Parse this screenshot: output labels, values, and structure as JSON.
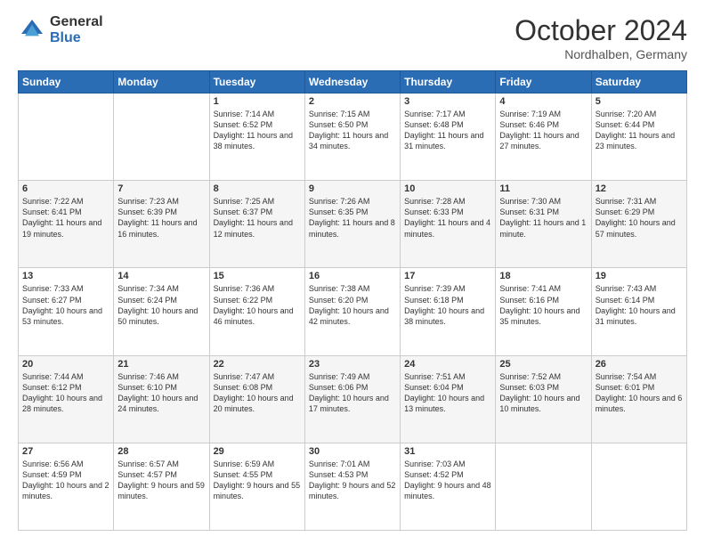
{
  "header": {
    "logo_general": "General",
    "logo_blue": "Blue",
    "month_title": "October 2024",
    "location": "Nordhalben, Germany"
  },
  "weekdays": [
    "Sunday",
    "Monday",
    "Tuesday",
    "Wednesday",
    "Thursday",
    "Friday",
    "Saturday"
  ],
  "weeks": [
    [
      {
        "day": "",
        "sunrise": "",
        "sunset": "",
        "daylight": ""
      },
      {
        "day": "",
        "sunrise": "",
        "sunset": "",
        "daylight": ""
      },
      {
        "day": "1",
        "sunrise": "Sunrise: 7:14 AM",
        "sunset": "Sunset: 6:52 PM",
        "daylight": "Daylight: 11 hours and 38 minutes."
      },
      {
        "day": "2",
        "sunrise": "Sunrise: 7:15 AM",
        "sunset": "Sunset: 6:50 PM",
        "daylight": "Daylight: 11 hours and 34 minutes."
      },
      {
        "day": "3",
        "sunrise": "Sunrise: 7:17 AM",
        "sunset": "Sunset: 6:48 PM",
        "daylight": "Daylight: 11 hours and 31 minutes."
      },
      {
        "day": "4",
        "sunrise": "Sunrise: 7:19 AM",
        "sunset": "Sunset: 6:46 PM",
        "daylight": "Daylight: 11 hours and 27 minutes."
      },
      {
        "day": "5",
        "sunrise": "Sunrise: 7:20 AM",
        "sunset": "Sunset: 6:44 PM",
        "daylight": "Daylight: 11 hours and 23 minutes."
      }
    ],
    [
      {
        "day": "6",
        "sunrise": "Sunrise: 7:22 AM",
        "sunset": "Sunset: 6:41 PM",
        "daylight": "Daylight: 11 hours and 19 minutes."
      },
      {
        "day": "7",
        "sunrise": "Sunrise: 7:23 AM",
        "sunset": "Sunset: 6:39 PM",
        "daylight": "Daylight: 11 hours and 16 minutes."
      },
      {
        "day": "8",
        "sunrise": "Sunrise: 7:25 AM",
        "sunset": "Sunset: 6:37 PM",
        "daylight": "Daylight: 11 hours and 12 minutes."
      },
      {
        "day": "9",
        "sunrise": "Sunrise: 7:26 AM",
        "sunset": "Sunset: 6:35 PM",
        "daylight": "Daylight: 11 hours and 8 minutes."
      },
      {
        "day": "10",
        "sunrise": "Sunrise: 7:28 AM",
        "sunset": "Sunset: 6:33 PM",
        "daylight": "Daylight: 11 hours and 4 minutes."
      },
      {
        "day": "11",
        "sunrise": "Sunrise: 7:30 AM",
        "sunset": "Sunset: 6:31 PM",
        "daylight": "Daylight: 11 hours and 1 minute."
      },
      {
        "day": "12",
        "sunrise": "Sunrise: 7:31 AM",
        "sunset": "Sunset: 6:29 PM",
        "daylight": "Daylight: 10 hours and 57 minutes."
      }
    ],
    [
      {
        "day": "13",
        "sunrise": "Sunrise: 7:33 AM",
        "sunset": "Sunset: 6:27 PM",
        "daylight": "Daylight: 10 hours and 53 minutes."
      },
      {
        "day": "14",
        "sunrise": "Sunrise: 7:34 AM",
        "sunset": "Sunset: 6:24 PM",
        "daylight": "Daylight: 10 hours and 50 minutes."
      },
      {
        "day": "15",
        "sunrise": "Sunrise: 7:36 AM",
        "sunset": "Sunset: 6:22 PM",
        "daylight": "Daylight: 10 hours and 46 minutes."
      },
      {
        "day": "16",
        "sunrise": "Sunrise: 7:38 AM",
        "sunset": "Sunset: 6:20 PM",
        "daylight": "Daylight: 10 hours and 42 minutes."
      },
      {
        "day": "17",
        "sunrise": "Sunrise: 7:39 AM",
        "sunset": "Sunset: 6:18 PM",
        "daylight": "Daylight: 10 hours and 38 minutes."
      },
      {
        "day": "18",
        "sunrise": "Sunrise: 7:41 AM",
        "sunset": "Sunset: 6:16 PM",
        "daylight": "Daylight: 10 hours and 35 minutes."
      },
      {
        "day": "19",
        "sunrise": "Sunrise: 7:43 AM",
        "sunset": "Sunset: 6:14 PM",
        "daylight": "Daylight: 10 hours and 31 minutes."
      }
    ],
    [
      {
        "day": "20",
        "sunrise": "Sunrise: 7:44 AM",
        "sunset": "Sunset: 6:12 PM",
        "daylight": "Daylight: 10 hours and 28 minutes."
      },
      {
        "day": "21",
        "sunrise": "Sunrise: 7:46 AM",
        "sunset": "Sunset: 6:10 PM",
        "daylight": "Daylight: 10 hours and 24 minutes."
      },
      {
        "day": "22",
        "sunrise": "Sunrise: 7:47 AM",
        "sunset": "Sunset: 6:08 PM",
        "daylight": "Daylight: 10 hours and 20 minutes."
      },
      {
        "day": "23",
        "sunrise": "Sunrise: 7:49 AM",
        "sunset": "Sunset: 6:06 PM",
        "daylight": "Daylight: 10 hours and 17 minutes."
      },
      {
        "day": "24",
        "sunrise": "Sunrise: 7:51 AM",
        "sunset": "Sunset: 6:04 PM",
        "daylight": "Daylight: 10 hours and 13 minutes."
      },
      {
        "day": "25",
        "sunrise": "Sunrise: 7:52 AM",
        "sunset": "Sunset: 6:03 PM",
        "daylight": "Daylight: 10 hours and 10 minutes."
      },
      {
        "day": "26",
        "sunrise": "Sunrise: 7:54 AM",
        "sunset": "Sunset: 6:01 PM",
        "daylight": "Daylight: 10 hours and 6 minutes."
      }
    ],
    [
      {
        "day": "27",
        "sunrise": "Sunrise: 6:56 AM",
        "sunset": "Sunset: 4:59 PM",
        "daylight": "Daylight: 10 hours and 2 minutes."
      },
      {
        "day": "28",
        "sunrise": "Sunrise: 6:57 AM",
        "sunset": "Sunset: 4:57 PM",
        "daylight": "Daylight: 9 hours and 59 minutes."
      },
      {
        "day": "29",
        "sunrise": "Sunrise: 6:59 AM",
        "sunset": "Sunset: 4:55 PM",
        "daylight": "Daylight: 9 hours and 55 minutes."
      },
      {
        "day": "30",
        "sunrise": "Sunrise: 7:01 AM",
        "sunset": "Sunset: 4:53 PM",
        "daylight": "Daylight: 9 hours and 52 minutes."
      },
      {
        "day": "31",
        "sunrise": "Sunrise: 7:03 AM",
        "sunset": "Sunset: 4:52 PM",
        "daylight": "Daylight: 9 hours and 48 minutes."
      },
      {
        "day": "",
        "sunrise": "",
        "sunset": "",
        "daylight": ""
      },
      {
        "day": "",
        "sunrise": "",
        "sunset": "",
        "daylight": ""
      }
    ]
  ]
}
